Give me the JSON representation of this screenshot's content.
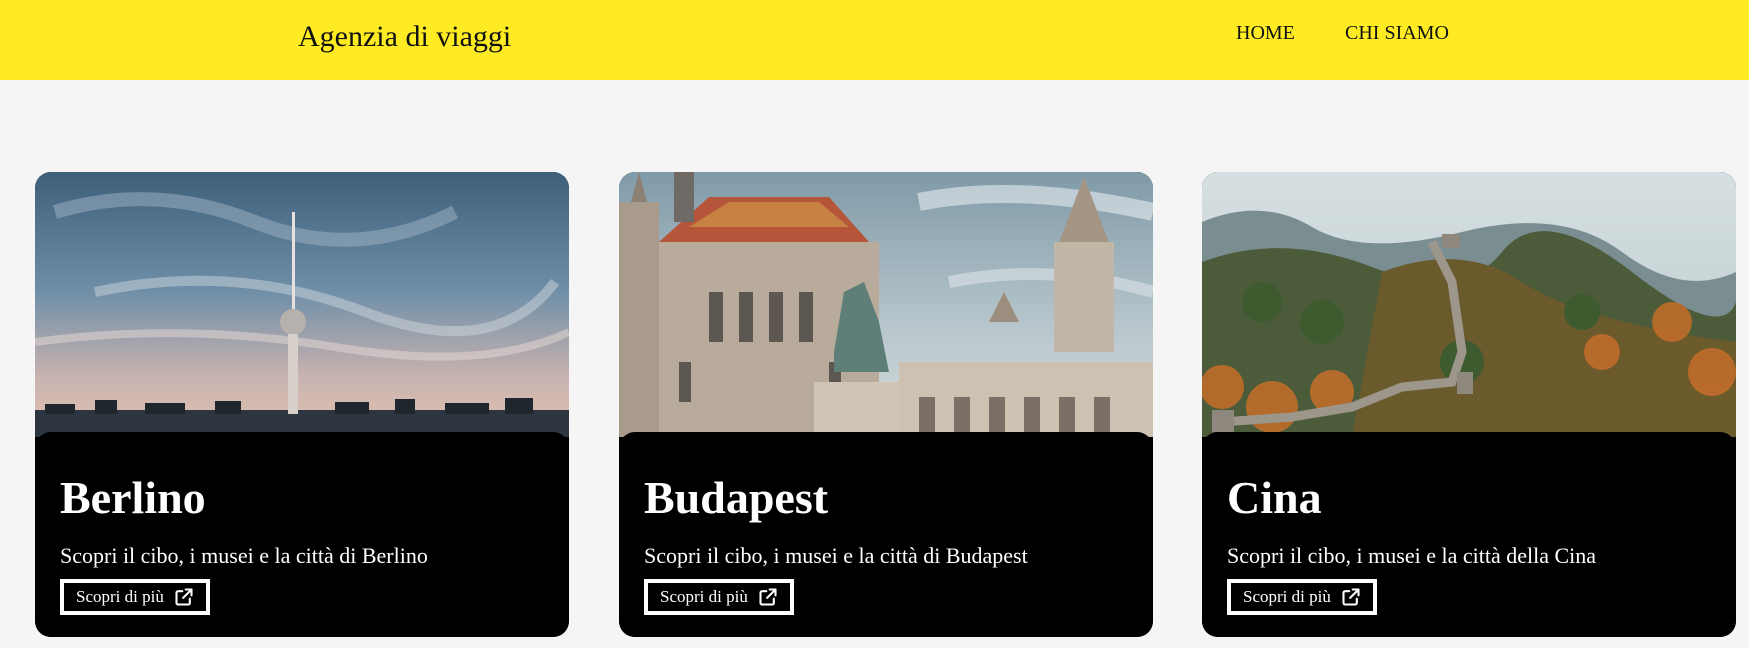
{
  "header": {
    "brand": "Agenzia di viaggi",
    "nav": [
      "HOME",
      "CHI SIAMO"
    ],
    "background": "#ffeb22"
  },
  "cards": [
    {
      "title": "Berlino",
      "description": "Scopri il cibo, i musei e la città di Berlino",
      "button_label": "Scopri di più",
      "button_icon": "external-link-icon",
      "image": "berlin-tv-tower-skyline"
    },
    {
      "title": "Budapest",
      "description": "Scopri il cibo, i musei e la città di Budapest",
      "button_label": "Scopri di più",
      "button_icon": "external-link-icon",
      "image": "budapest-matthias-church-fishermans-bastion"
    },
    {
      "title": "Cina",
      "description": "Scopri il cibo, i musei e la città della Cina",
      "button_label": "Scopri di più",
      "button_icon": "external-link-icon",
      "image": "great-wall-of-china-autumn"
    }
  ]
}
